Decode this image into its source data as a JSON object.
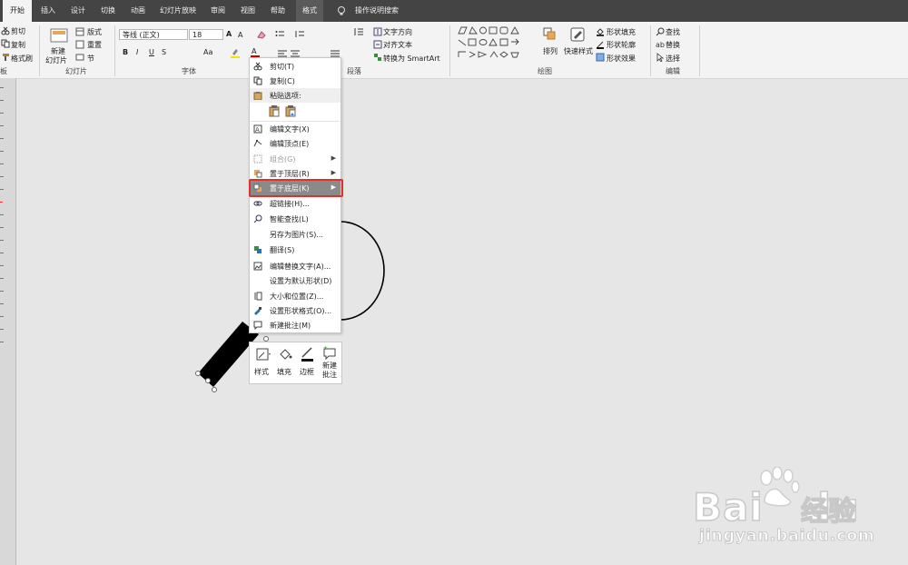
{
  "tabs": [
    {
      "label": "开始",
      "active": true
    },
    {
      "label": "插入"
    },
    {
      "label": "设计"
    },
    {
      "label": "切换"
    },
    {
      "label": "动画"
    },
    {
      "label": "幻灯片放映"
    },
    {
      "label": "审阅"
    },
    {
      "label": "视图"
    },
    {
      "label": "帮助"
    },
    {
      "label": "格式"
    }
  ],
  "search": {
    "label": "操作说明搜索"
  },
  "clipboard": {
    "cut": "剪切",
    "copy": "复制",
    "format_painter": "格式刷",
    "group": "板"
  },
  "slides": {
    "new_slide": "新建",
    "new_slide2": "幻灯片",
    "layout": "版式",
    "reset": "重置",
    "section": "节",
    "group": "幻灯片"
  },
  "font": {
    "name": "等线 (正文)",
    "size": "18",
    "group": "字体"
  },
  "paragraph": {
    "text_direction": "文字方向",
    "align_text": "对齐文本",
    "smartart": "转换为 SmartArt",
    "group": "段落"
  },
  "drawing": {
    "arrange": "排列",
    "quick_styles": "快速样式",
    "shape_fill": "形状填充",
    "shape_outline": "形状轮廓",
    "shape_effects": "形状效果",
    "group": "绘图"
  },
  "editing": {
    "find": "查找",
    "replace": "替换",
    "select": "选择",
    "group": "编辑"
  },
  "context_menu": {
    "cut": "剪切(T)",
    "copy": "复制(C)",
    "paste_options": "粘贴选项:",
    "edit_text": "编辑文字(X)",
    "edit_points": "编辑顶点(E)",
    "group": "组合(G)",
    "bring_front": "置于顶层(R)",
    "send_back": "置于底层(K)",
    "hyperlink": "超链接(H)...",
    "smart_lookup": "智能查找(L)",
    "save_as_picture": "另存为图片(S)...",
    "translate": "翻译(S)",
    "edit_alt_text": "编辑替换文字(A)...",
    "set_default_shape": "设置为默认形状(D)",
    "size_position": "大小和位置(Z)...",
    "format_shape": "设置形状格式(O)...",
    "new_comment": "新建批注(M)"
  },
  "mini_toolbar": {
    "style": "样式",
    "fill": "填充",
    "outline": "边框",
    "new_comment_1": "新建",
    "new_comment_2": "批注"
  },
  "watermark": {
    "brand": "Bai",
    "brand2": "du",
    "brand_cn": "经验",
    "url": "jingyan.baidu.com"
  },
  "colors": {
    "tabbar": "#444444",
    "ribbon": "#f3f3f3",
    "highlight_border": "#e0302a",
    "canvas": "#e6e6e6"
  }
}
